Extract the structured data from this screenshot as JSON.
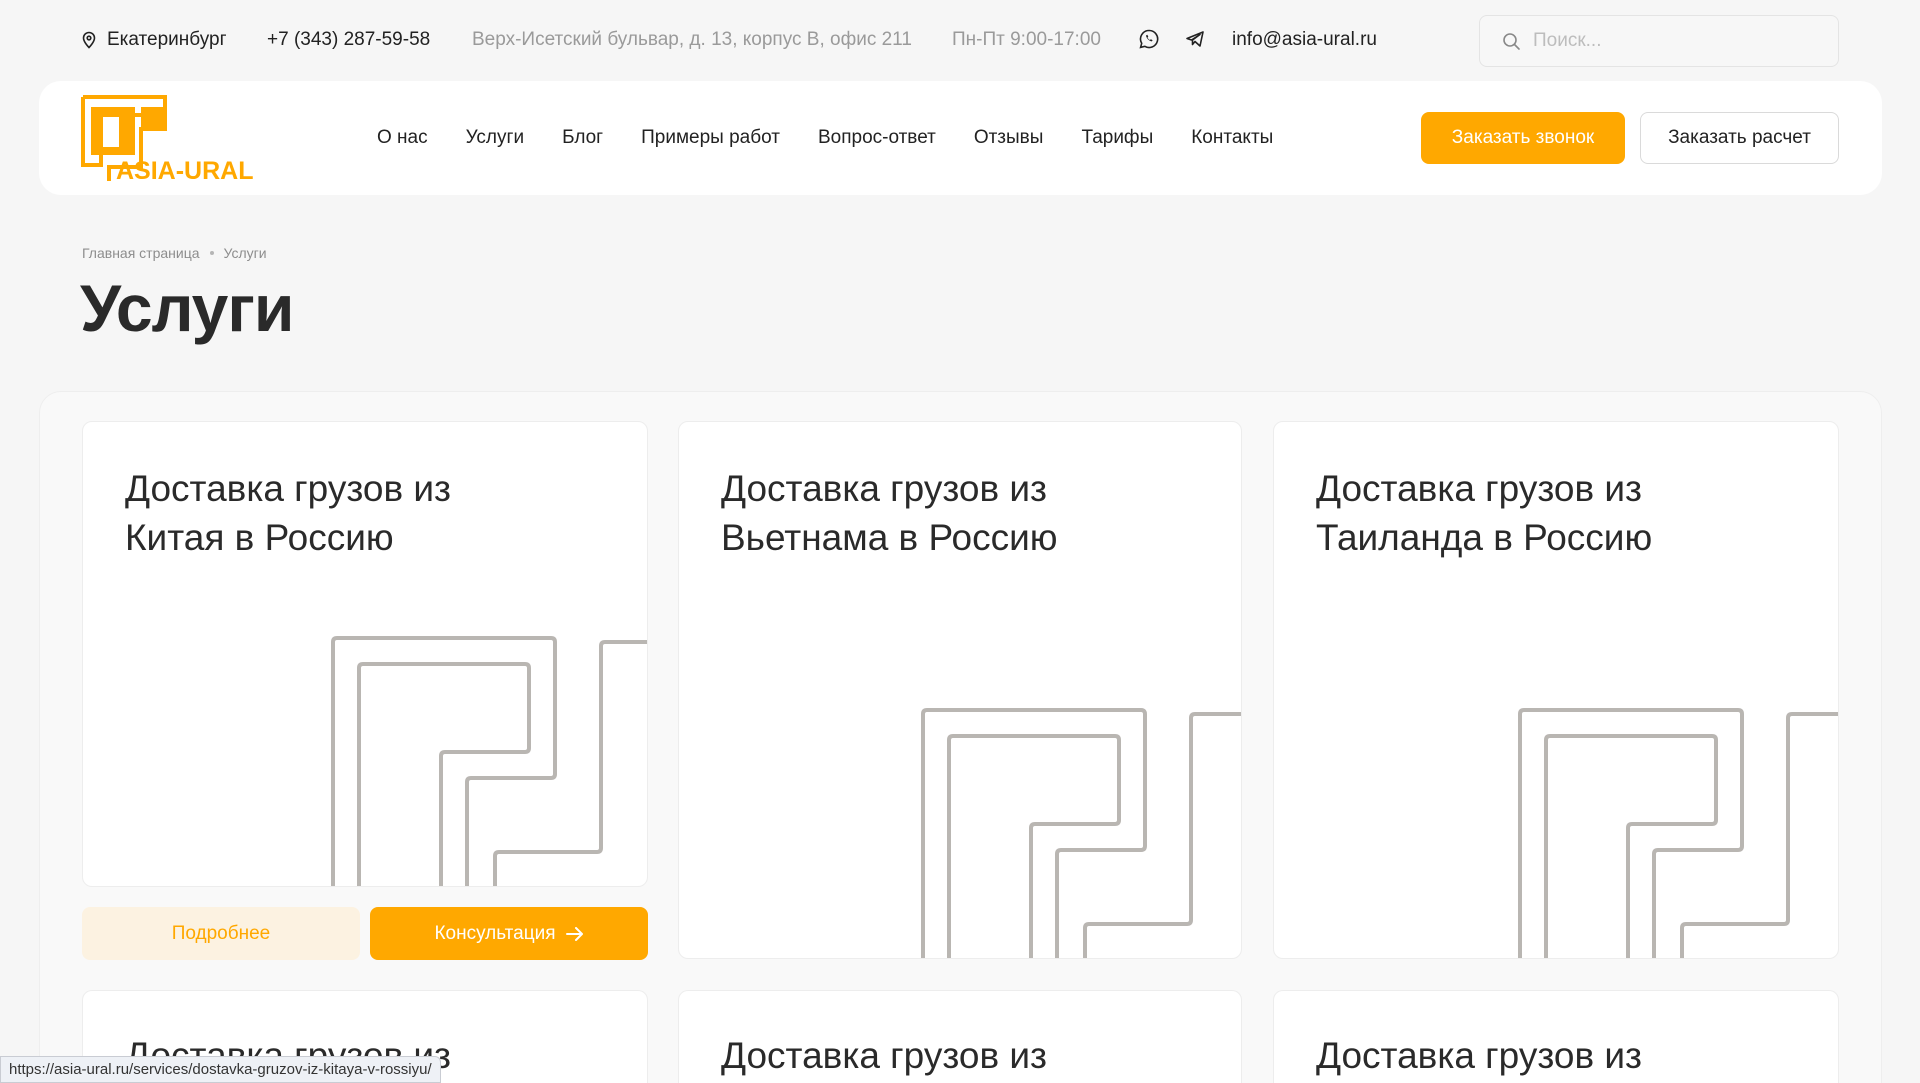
{
  "topbar": {
    "city": "Екатеринбург",
    "phone": "+7 (343) 287-59-58",
    "address": "Верх-Исетский бульвар, д. 13, корпус В, офис 211",
    "hours": "Пн-Пт 9:00-17:00",
    "email": "info@asia-ural.ru",
    "search_placeholder": "Поиск..."
  },
  "header": {
    "logo_text": "ASIA-URAL",
    "nav": [
      "О нас",
      "Услуги",
      "Блог",
      "Примеры работ",
      "Вопрос-ответ",
      "Отзывы",
      "Тарифы",
      "Контакты"
    ],
    "call_button": "Заказать звонок",
    "calc_button": "Заказать расчет"
  },
  "breadcrumb": [
    "Главная страница",
    "Услуги"
  ],
  "page_title": "Услуги",
  "cards": [
    {
      "title_line1": "Доставка грузов из",
      "title_line2": "Китая в Россию"
    },
    {
      "title_line1": "Доставка грузов из",
      "title_line2": "Вьетнама в Россию"
    },
    {
      "title_line1": "Доставка грузов из",
      "title_line2": "Таиланда в Россию"
    },
    {
      "title_line1": "Доставка грузов из",
      "title_line2": ""
    },
    {
      "title_line1": "Доставка грузов из",
      "title_line2": ""
    },
    {
      "title_line1": "Доставка грузов из",
      "title_line2": ""
    }
  ],
  "card_actions": {
    "more": "Подробнее",
    "consult": "Консультация"
  },
  "status_url": "https://asia-ural.ru/services/dostavka-gruzov-iz-kitaya-v-rossiyu/",
  "colors": {
    "accent": "#ffa800",
    "accent_light": "#fcf2e1",
    "background": "#f6f6f6",
    "pattern_stroke": "#b9b6b2"
  },
  "icons": [
    "location-pin-icon",
    "whatsapp-icon",
    "telegram-icon",
    "search-icon",
    "arrow-right-icon"
  ]
}
